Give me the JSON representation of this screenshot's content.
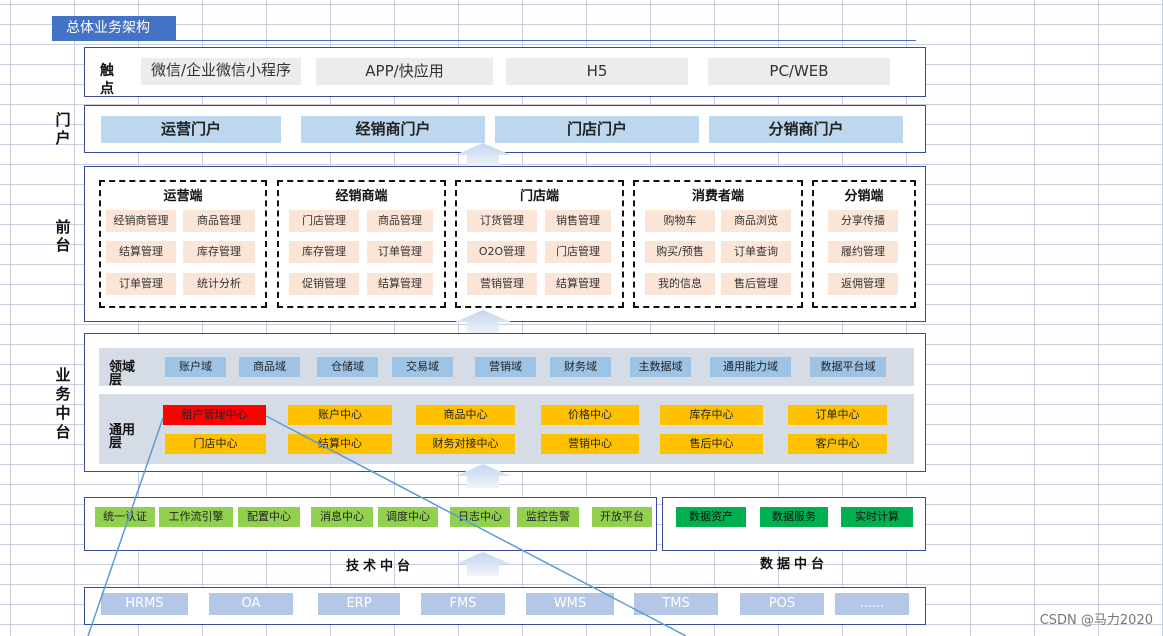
{
  "title": "总体业务架构",
  "touch": {
    "label": "触点",
    "items": [
      "微信/企业微信小程序",
      "APP/快应用",
      "H5",
      "PC/WEB"
    ]
  },
  "portal": {
    "label": "门户",
    "items": [
      "运营门户",
      "经销商门户",
      "门店门户",
      "分销商门户"
    ]
  },
  "frontend": {
    "label": "前台",
    "groups": [
      {
        "title": "运营端",
        "items": [
          "经销商管理",
          "商品管理",
          "结算管理",
          "库存管理",
          "订单管理",
          "统计分析"
        ]
      },
      {
        "title": "经销商端",
        "items": [
          "门店管理",
          "商品管理",
          "库存管理",
          "订单管理",
          "促销管理",
          "结算管理"
        ]
      },
      {
        "title": "门店端",
        "items": [
          "订货管理",
          "销售管理",
          "O2O管理",
          "门店管理",
          "营销管理",
          "结算管理"
        ]
      },
      {
        "title": "消费者端",
        "items": [
          "购物车",
          "商品浏览",
          "购买/预售",
          "订单查询",
          "我的信息",
          "售后管理"
        ]
      },
      {
        "title": "分销端",
        "items": [
          "分享传播",
          "履约管理",
          "返佣管理"
        ]
      }
    ]
  },
  "business": {
    "label": "业务中台",
    "domain_layer": "领域层",
    "domains": [
      "账户域",
      "商品域",
      "仓储域",
      "交易域",
      "营销域",
      "财务域",
      "主数据域",
      "通用能力域",
      "数据平台域"
    ],
    "common_layer": "通用层",
    "row1": [
      "租户管理中心",
      "账户中心",
      "商品中心",
      "价格中心",
      "库存中心",
      "订单中心"
    ],
    "row2": [
      "门店中心",
      "结算中心",
      "财务对接中心",
      "营销中心",
      "售后中心",
      "客户中心"
    ]
  },
  "tech": {
    "label": "技术中台",
    "items": [
      "统一认证",
      "工作流引擎",
      "配置中心",
      "消息中心",
      "调度中心",
      "日志中心",
      "监控告警",
      "开放平台"
    ]
  },
  "data_platform": {
    "label": "数据中台",
    "items": [
      "数据资产",
      "数据服务",
      "实时计算"
    ]
  },
  "systems": [
    "HRMS",
    "OA",
    "ERP",
    "FMS",
    "WMS",
    "TMS",
    "POS",
    "......"
  ],
  "watermark": "CSDN @马力2020",
  "colors": {
    "accent": "#4472c4",
    "frame": "#3a4b98",
    "portal": "#bdd7ee",
    "front_item": "#fbe5d6",
    "domain": "#9dc3e6",
    "common": "#ffc000",
    "highlight": "#ff0000",
    "tech": "#92d050",
    "data": "#00b050",
    "system": "#b4c7e7"
  }
}
